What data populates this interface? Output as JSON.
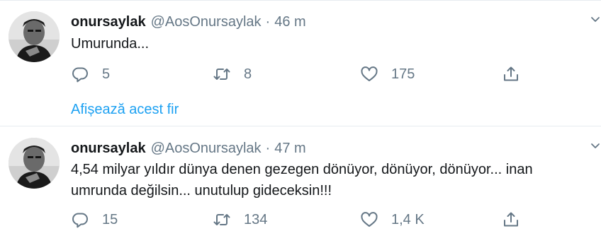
{
  "tweets": [
    {
      "display_name": "onursaylak",
      "handle": "@AosOnursaylak",
      "separator": "·",
      "time": "46 m",
      "text": "Umurunda...",
      "replies": "5",
      "retweets": "8",
      "likes": "175",
      "show_thread": "Afișează acest fir"
    },
    {
      "display_name": "onursaylak",
      "handle": "@AosOnursaylak",
      "separator": "·",
      "time": "47 m",
      "text": "4,54 milyar yıldır dünya denen gezegen dönüyor, dönüyor, dönüyor... inan\numrunda değilsin... unutulup gideceksin!!!",
      "replies": "15",
      "retweets": "134",
      "likes": "1,4 K"
    }
  ],
  "icons": {
    "reply": "reply-icon",
    "retweet": "retweet-icon",
    "like": "heart-icon",
    "share": "share-icon",
    "caret": "chevron-down-icon"
  },
  "colors": {
    "text": "#14171a",
    "secondary": "#657786",
    "link": "#1da1f2",
    "divider": "#e6ecf0"
  }
}
